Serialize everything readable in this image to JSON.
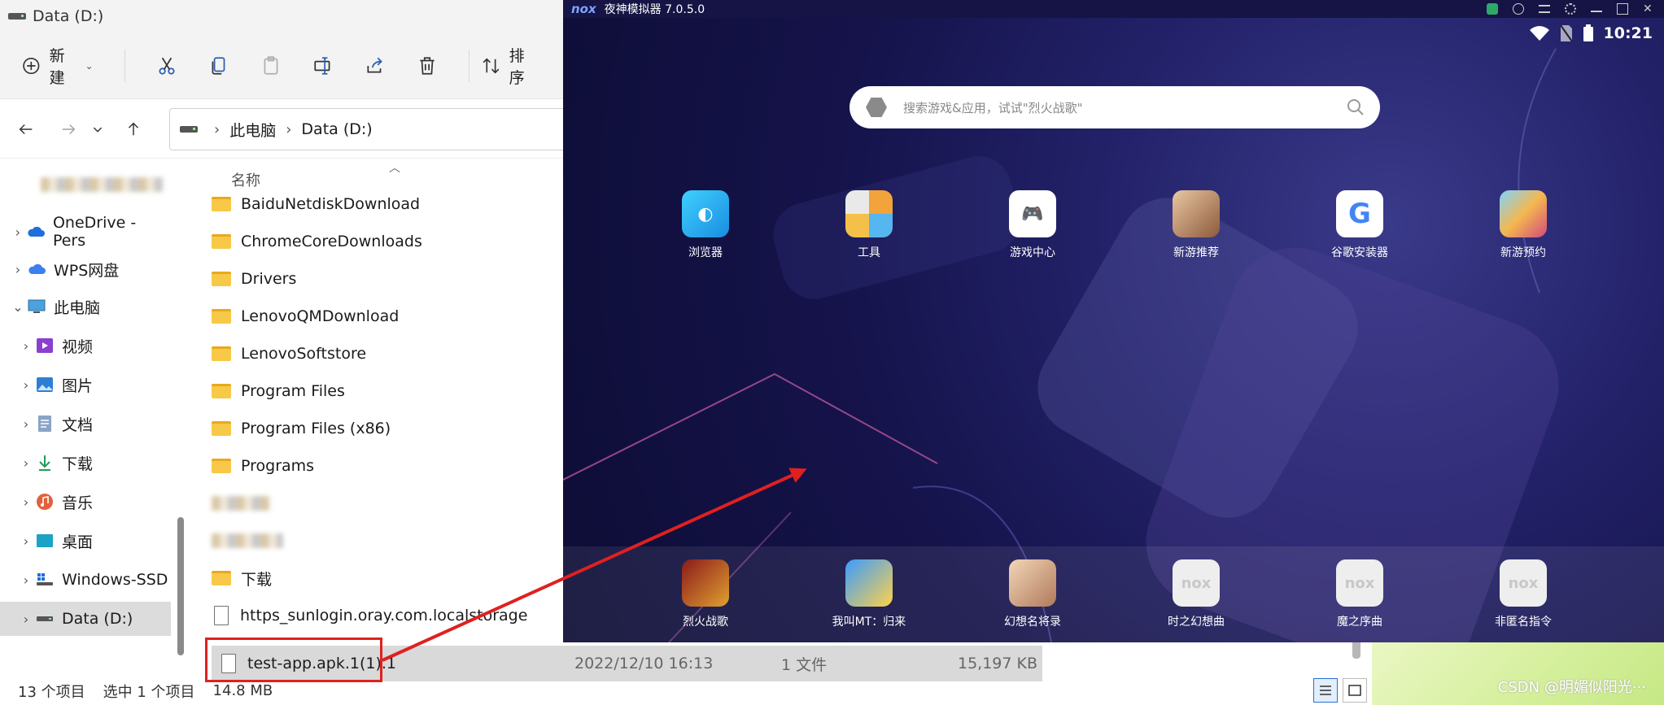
{
  "explorer": {
    "title": "Data (D:)",
    "ribbon": {
      "new_label": "新建",
      "sort_label": "排序"
    },
    "address": {
      "crumbs": [
        "此电脑",
        "Data (D:)"
      ]
    },
    "nav": {
      "onedrive": "OneDrive - Pers",
      "wps": "WPS网盘",
      "thispc": "此电脑",
      "videos": "视频",
      "pictures": "图片",
      "documents": "文档",
      "downloads": "下载",
      "music": "音乐",
      "desktop": "桌面",
      "windows_ssd": "Windows-SSD",
      "data_d": "Data (D:)"
    },
    "file_list": {
      "name_header": "名称",
      "folders": [
        "BaiduNetdiskDownload",
        "ChromeCoreDownloads",
        "Drivers",
        "LenovoQMDownload",
        "LenovoSoftstore",
        "Program Files",
        "Program Files (x86)",
        "Programs",
        "下载"
      ],
      "file_storage": "https_sunlogin.oray.com.localstorage",
      "selected_file": {
        "name": "test-app.apk.1(1).1",
        "date": "2022/12/10 16:13",
        "type": "1 文件",
        "size": "15,197 KB"
      }
    },
    "status": {
      "count": "13 个项目",
      "selected": "选中 1 个项目",
      "size": "14.8 MB"
    }
  },
  "nox": {
    "title": "夜神模拟器 7.0.5.0",
    "logo": "nox",
    "time": "10:21",
    "search_placeholder": "搜索游戏&应用，试试\"烈火战歌\"",
    "apps_top": [
      "浏览器",
      "工具",
      "游戏中心",
      "新游推荐",
      "谷歌安装器",
      "新游预约"
    ],
    "apps_dock": [
      "烈火战歌",
      "我叫MT：归来",
      "幻想名将录",
      "时之幻想曲",
      "魔之序曲",
      "非匿名指令"
    ]
  },
  "watermark": "CSDN @明媚似阳光···",
  "colors": {
    "arrow_red": "#e02020",
    "nox_bg": "#15134a",
    "folder_yellow": "#f8c948"
  }
}
